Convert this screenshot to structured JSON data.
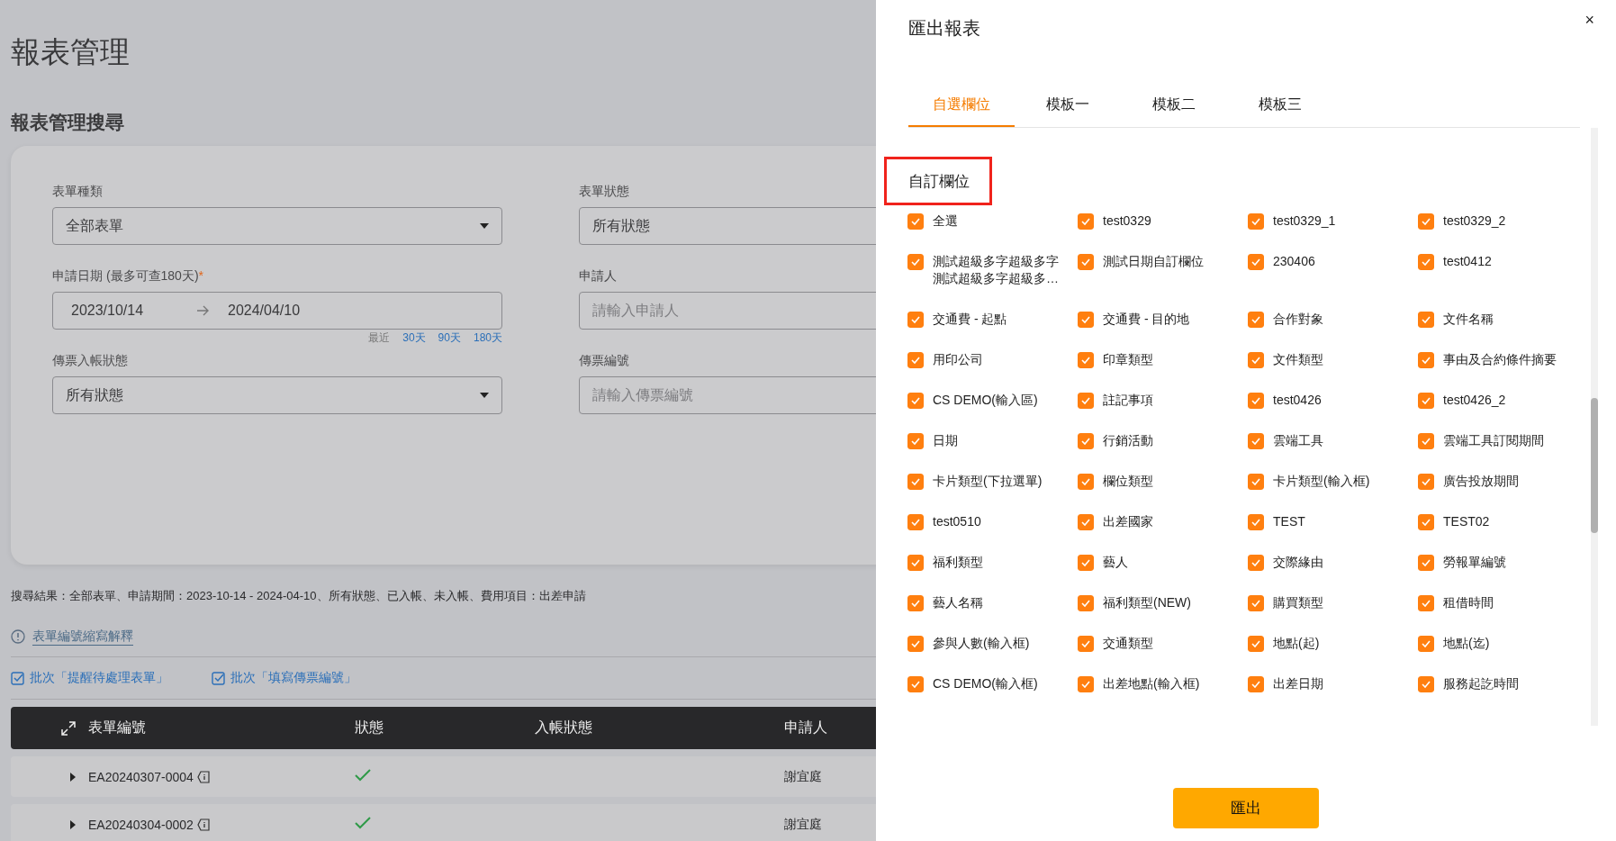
{
  "page": {
    "title": "報表管理",
    "section_title": "報表管理搜尋"
  },
  "form": {
    "fields": [
      {
        "kind": "select",
        "label": "表單種類",
        "value": "全部表單"
      },
      {
        "kind": "select",
        "label": "表單狀態",
        "value": "所有狀態"
      },
      {
        "kind": "date_range",
        "label": "申請日期 (最多可查180天)",
        "required_mark": "*",
        "start": "2023/10/14",
        "end": "2024/04/10",
        "quick_prefix": "最近",
        "quick_options": [
          "30天",
          "90天",
          "180天"
        ]
      },
      {
        "kind": "text",
        "label": "申請人",
        "placeholder": "請輸入申請人"
      },
      {
        "kind": "select",
        "label": "傳票入帳狀態",
        "value": "所有狀態"
      },
      {
        "kind": "text",
        "label": "傳票編號",
        "placeholder": "請輸入傳票編號"
      }
    ]
  },
  "search_summary": "搜尋結果：全部表單、申請期間：2023-10-14 - 2024-04-10、所有狀態、已入帳、未入帳、費用項目：出差申請",
  "info_link": "表單編號縮寫解釋",
  "batch_actions": [
    "批次「提醒待處理表單」",
    "批次「填寫傳票編號」"
  ],
  "table": {
    "columns": [
      "表單編號",
      "狀態",
      "入帳狀態",
      "申請人"
    ],
    "rows": [
      {
        "id": "EA20240307-0004",
        "approved": true,
        "applicant": "謝宜庭"
      },
      {
        "id": "EA20240304-0002",
        "approved": true,
        "applicant": "謝宜庭"
      }
    ]
  },
  "drawer": {
    "title": "匯出報表",
    "close": "×",
    "tabs": [
      {
        "label": "自選欄位",
        "selected": true
      },
      {
        "label": "模板一",
        "selected": false
      },
      {
        "label": "模板二",
        "selected": false
      },
      {
        "label": "模板三",
        "selected": false
      }
    ],
    "section_title": "自訂欄位",
    "fields": [
      {
        "label": "全選",
        "checked": true
      },
      {
        "label": "test0329",
        "checked": true
      },
      {
        "label": "test0329_1",
        "checked": true
      },
      {
        "label": "test0329_2",
        "checked": true
      },
      {
        "label": "測試超級多字超級多字測試超級多字超級多…",
        "checked": true
      },
      {
        "label": "測試日期自訂欄位",
        "checked": true
      },
      {
        "label": "230406",
        "checked": true
      },
      {
        "label": "test0412",
        "checked": true
      },
      {
        "label": "交通費 - 起點",
        "checked": true
      },
      {
        "label": "交通費 - 目的地",
        "checked": true
      },
      {
        "label": "合作對象",
        "checked": true
      },
      {
        "label": "文件名稱",
        "checked": true
      },
      {
        "label": "用印公司",
        "checked": true
      },
      {
        "label": "印章類型",
        "checked": true
      },
      {
        "label": "文件類型",
        "checked": true
      },
      {
        "label": "事由及合約條件摘要",
        "checked": true
      },
      {
        "label": "CS DEMO(輸入區)",
        "checked": true
      },
      {
        "label": "註記事項",
        "checked": true
      },
      {
        "label": "test0426",
        "checked": true
      },
      {
        "label": "test0426_2",
        "checked": true
      },
      {
        "label": "日期",
        "checked": true
      },
      {
        "label": "行銷活動",
        "checked": true
      },
      {
        "label": "雲端工具",
        "checked": true
      },
      {
        "label": "雲端工具訂閱期間",
        "checked": true
      },
      {
        "label": "卡片類型(下拉選單)",
        "checked": true
      },
      {
        "label": "欄位類型",
        "checked": true
      },
      {
        "label": "卡片類型(輸入框)",
        "checked": true
      },
      {
        "label": "廣告投放期間",
        "checked": true
      },
      {
        "label": "test0510",
        "checked": true
      },
      {
        "label": "出差國家",
        "checked": true
      },
      {
        "label": "TEST",
        "checked": true
      },
      {
        "label": "TEST02",
        "checked": true
      },
      {
        "label": "福利類型",
        "checked": true
      },
      {
        "label": "藝人",
        "checked": true
      },
      {
        "label": "交際緣由",
        "checked": true
      },
      {
        "label": "勞報單編號",
        "checked": true
      },
      {
        "label": "藝人名稱",
        "checked": true
      },
      {
        "label": "福利類型(NEW)",
        "checked": true
      },
      {
        "label": "購買類型",
        "checked": true
      },
      {
        "label": "租借時間",
        "checked": true
      },
      {
        "label": "參與人數(輸入框)",
        "checked": true
      },
      {
        "label": "交通類型",
        "checked": true
      },
      {
        "label": "地點(起)",
        "checked": true
      },
      {
        "label": "地點(迄)",
        "checked": true
      },
      {
        "label": "CS DEMO(輸入框)",
        "checked": true
      },
      {
        "label": "出差地點(輸入框)",
        "checked": true
      },
      {
        "label": "出差日期",
        "checked": true
      },
      {
        "label": "服務起訖時間",
        "checked": true
      }
    ],
    "export_button": "匯出"
  }
}
